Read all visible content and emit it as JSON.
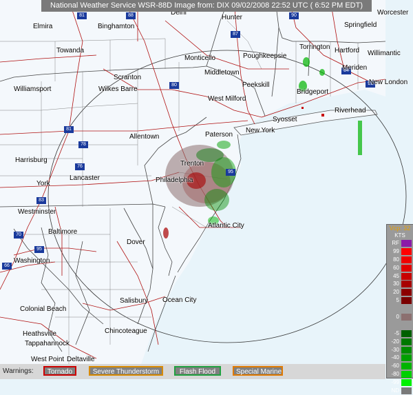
{
  "header": {
    "title": "National Weather Service WSR-88D Image from: DIX 09/02/2008 22:52 UTC ( 6:52 PM EDT)"
  },
  "cities": [
    "Elmira",
    "Binghamton",
    "Delhi",
    "Hunter",
    "Worcester",
    "Springfield",
    "Towanda",
    "Monticello",
    "Poughkeepsie",
    "Torrington",
    "Hartford",
    "Willimantic",
    "Middletown",
    "Meriden",
    "New London",
    "Williamsport",
    "Scranton",
    "Wilkes Barre",
    "Peekskill",
    "Bridgeport",
    "West Milford",
    "Riverhead",
    "Syosset",
    "Paterson",
    "New York",
    "Allentown",
    "Harrisburg",
    "Trenton",
    "York",
    "Lancaster",
    "Philadelphia",
    "Westminster",
    "Baltimore",
    "Atlantic City",
    "Dover",
    "Washington",
    "Salisbury",
    "Ocean City",
    "Colonial Beach",
    "Chincoteague",
    "Heathsville",
    "Tappahannock",
    "West Point",
    "Deltaville"
  ],
  "highways": [
    "88",
    "81",
    "87",
    "90",
    "84",
    "91",
    "95",
    "80",
    "81",
    "78",
    "76",
    "83",
    "70",
    "95",
    "66"
  ],
  "legend": {
    "header": "Vcp: 32",
    "unit": "KTS",
    "levels": [
      {
        "label": "RF",
        "color": "#8c1aa8"
      },
      {
        "label": "99",
        "color": "#ff0000"
      },
      {
        "label": "80",
        "color": "#f00000"
      },
      {
        "label": "60",
        "color": "#e00000"
      },
      {
        "label": "45",
        "color": "#c80000"
      },
      {
        "label": "30",
        "color": "#a80000"
      },
      {
        "label": "20",
        "color": "#8c0000"
      },
      {
        "label": "5",
        "color": "#7a0000"
      },
      {
        "label": "",
        "color": "#9a9a9a"
      },
      {
        "label": "0",
        "color": "#8c7070"
      },
      {
        "label": "",
        "color": "#9a9a9a"
      },
      {
        "label": "-5",
        "color": "#006000"
      },
      {
        "label": "-20",
        "color": "#007800"
      },
      {
        "label": "-30",
        "color": "#008c00"
      },
      {
        "label": "-40",
        "color": "#00a000"
      },
      {
        "label": "-60",
        "color": "#00b400"
      },
      {
        "label": "-80",
        "color": "#00d000"
      },
      {
        "label": "-99",
        "color": "#00f000"
      },
      {
        "label": "ND",
        "color": "#7a7a7a"
      }
    ]
  },
  "warnings": {
    "label": "Warnings:",
    "items": [
      {
        "label": "Tornado",
        "color": "#cc0000"
      },
      {
        "label": "Severe Thunderstorm",
        "color": "#d88a00"
      },
      {
        "label": "Flash Flood",
        "color": "#20a040"
      },
      {
        "label": "Special Marine",
        "color": "#e07a00"
      }
    ]
  }
}
